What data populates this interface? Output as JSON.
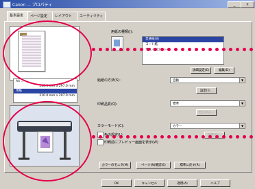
{
  "window": {
    "title": "Canon ... プロパティ",
    "controls": [
      "_",
      "□",
      "×"
    ]
  },
  "tabs": [
    {
      "label": "基本設定"
    },
    {
      "label": "ページ設定"
    },
    {
      "label": "レイアウト"
    },
    {
      "label": "ユーティリティ"
    }
  ],
  "preview": {
    "paper_list": [
      {
        "label": "A4 ..."
      },
      {
        "label": "210.0 mm x 297.0 mm",
        "selected": false
      },
      {
        "label": "用紙",
        "selected": true
      },
      {
        "label": "210.0 mm x 297.0 mm",
        "selected": false
      }
    ]
  },
  "main": {
    "paper_type_label": "用紙の種類(J):",
    "paper_types": [
      {
        "label": "普通紙(B)",
        "selected": true
      },
      {
        "label": "コート紙",
        "selected": false
      },
      {
        "label": "写真 (グロッシー)",
        "selected": false
      }
    ],
    "detail_button": "詳細設定(E)",
    "edit_button": "編集(D)",
    "source_label": "給紙の方法(S):",
    "source_value": "自動",
    "settings_button": "設定(I)...",
    "quality_label": "印刷品質(Q):",
    "quality_value": "標準",
    "quality_button": "カスタム...",
    "color_label": "カラーモード(C):",
    "color_value": "カラー",
    "color_button": "設定(G)...",
    "check_grayscale": "色の設定(L)",
    "check_preview": "印刷前にプレビュー画面を表示(W)",
    "footer_buttons": [
      "カラーのモニタ(M)",
      "ページ(N)確認(E)",
      "標準に戻す(R)"
    ]
  },
  "dialog_buttons": [
    "OK",
    "キャンセル",
    "適用(A)",
    "ヘルプ"
  ],
  "colors": {
    "highlight": "#e4004b",
    "selection": "#2b45a4"
  }
}
